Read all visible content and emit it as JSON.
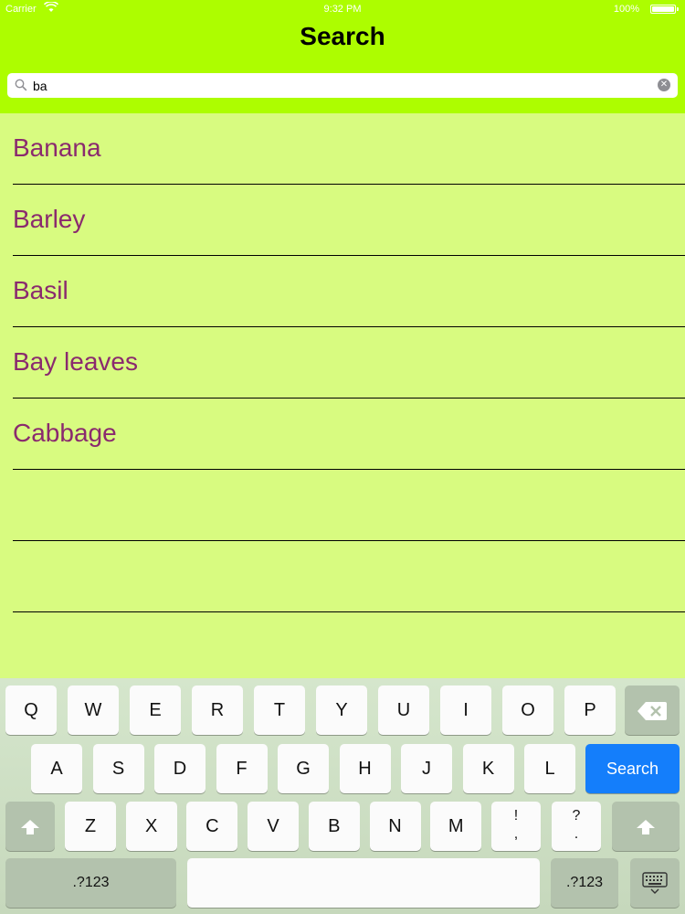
{
  "status_bar": {
    "carrier": "Carrier",
    "time": "9:32 PM",
    "battery": "100%"
  },
  "nav": {
    "title": "Search"
  },
  "search": {
    "value": "ba",
    "placeholder": ""
  },
  "results": [
    "Banana",
    "Barley",
    "Basil",
    "Bay leaves",
    "Cabbage",
    "",
    ""
  ],
  "colors": {
    "nav_bg": "#adfd00",
    "list_bg": "#d8fb80",
    "item_text": "#8a2a6e",
    "search_key": "#147efb"
  },
  "keyboard": {
    "row1": [
      "Q",
      "W",
      "E",
      "R",
      "T",
      "Y",
      "U",
      "I",
      "O",
      "P"
    ],
    "row2": [
      "A",
      "S",
      "D",
      "F",
      "G",
      "H",
      "J",
      "K",
      "L"
    ],
    "row3": [
      "Z",
      "X",
      "C",
      "V",
      "B",
      "N",
      "M"
    ],
    "punct1": [
      "!",
      ","
    ],
    "punct2": [
      "?",
      "."
    ],
    "search_label": "Search",
    "numbers_label": ".?123",
    "icons": [
      "backspace-icon",
      "shift-icon",
      "keyboard-dismiss-icon"
    ]
  }
}
